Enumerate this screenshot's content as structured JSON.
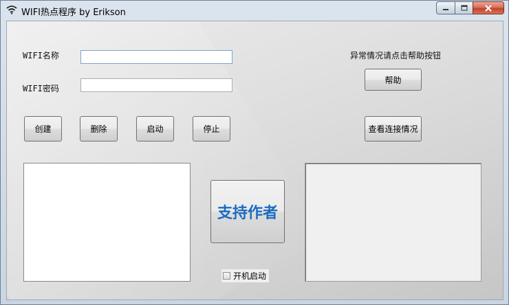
{
  "window": {
    "title": "WIFI热点程序 by Erikson",
    "icon": "wifi-icon",
    "controls": {
      "minimize_icon": "minimize-icon",
      "maximize_icon": "maximize-icon",
      "close_icon": "close-icon"
    }
  },
  "form": {
    "ssid_label": "WIFI名称",
    "ssid_value": "",
    "password_label": "WIFI密码",
    "password_value": "",
    "help_hint": "异常情况请点击帮助按钮"
  },
  "buttons": {
    "create": "创建",
    "delete": "删除",
    "start": "启动",
    "stop": "停止",
    "help": "帮助",
    "view_connections": "查看连接情况",
    "support_author": "支持作者"
  },
  "autostart": {
    "label": "开机启动",
    "checked": false
  },
  "colors": {
    "accent": "#1a6bc2",
    "close_button": "#c3432a"
  }
}
